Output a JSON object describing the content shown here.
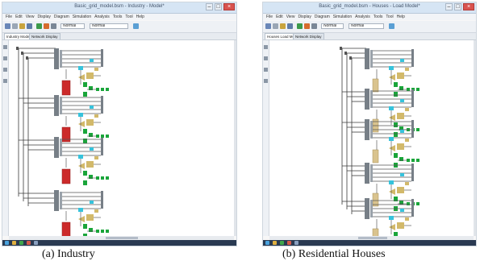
{
  "colors": {
    "titlebar": "#d6e5f4",
    "bus": "#777f87",
    "line": "#3a3a3a",
    "cyan": "#36c3dc",
    "gold": "#d2b96a",
    "green": "#1aa53a",
    "red_load": "#cc2a2a",
    "tan_load": "#d9c38e",
    "close_button": "#d9534f",
    "taskbar": "#2a3a52"
  },
  "panels": [
    {
      "window_title": "Basic_grid_model.bsm - Industry - Model*",
      "menu": [
        "File",
        "Edit",
        "View",
        "Display",
        "Diagram",
        "Simulation",
        "Analysis",
        "Tools",
        "Tool",
        "Help"
      ],
      "toolbar": {
        "zoom_field": "Normal",
        "scale_field": "Normal"
      },
      "tabs": [
        "Industry Model",
        "Network Display"
      ],
      "load_color": "#cc2a2a",
      "variant": "industry"
    },
    {
      "window_title": "Basic_grid_model.bsm - Houses - Load Model*",
      "menu": [
        "File",
        "Edit",
        "View",
        "Display",
        "Diagram",
        "Simulation",
        "Analysis",
        "Tools",
        "Tool",
        "Help"
      ],
      "toolbar": {
        "zoom_field": "Normal",
        "scale_field": "Normal"
      },
      "tabs": [
        "Houses Load Model",
        "Network Display"
      ],
      "load_color": "#d9c38e",
      "variant": "houses"
    }
  ],
  "captions": {
    "a": "(a) Industry",
    "b": "(b) Residential Houses"
  }
}
